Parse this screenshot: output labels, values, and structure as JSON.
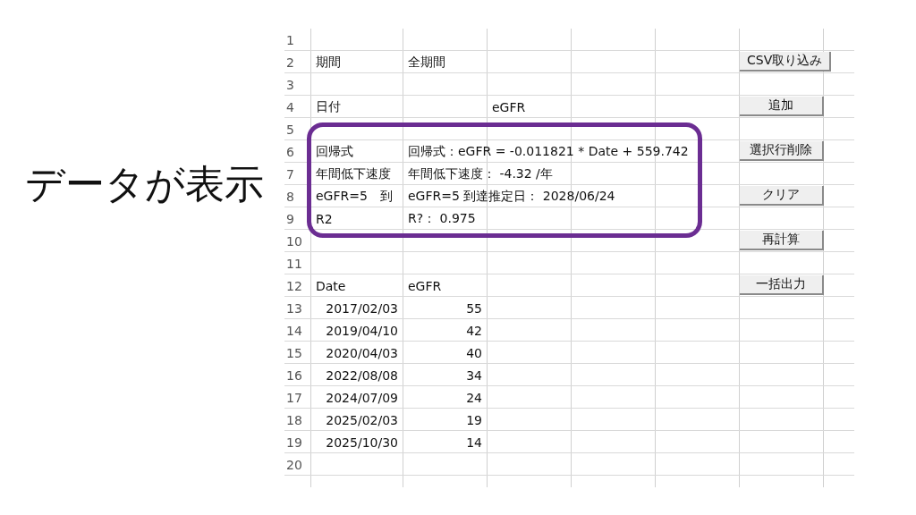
{
  "caption": "データが表示",
  "sheet": {
    "rows": [
      {
        "number": "1"
      },
      {
        "number": "2",
        "column_1": "期間",
        "column_2": "全期間",
        "button": "CSV取り込み"
      },
      {
        "number": "3"
      },
      {
        "number": "4",
        "column_1": "日付",
        "column_3": "eGFR",
        "button": "追加"
      },
      {
        "number": "5"
      },
      {
        "number": "6",
        "column_1": "回帰式",
        "column_2": "回帰式：eGFR = -0.011821 * Date + 559.742",
        "button": "選択行削除"
      },
      {
        "number": "7",
        "column_1": "年間低下速度",
        "column_2": "年間低下速度： -4.32 /年"
      },
      {
        "number": "8",
        "column_1": "eGFR=5　到",
        "column_2": "eGFR=5 到達推定日： 2028/06/24",
        "button": "クリア"
      },
      {
        "number": "9",
        "column_1": "R2",
        "column_2": "R?： 0.975"
      },
      {
        "number": "10",
        "button": "再計算"
      },
      {
        "number": "11"
      },
      {
        "number": "12",
        "column_1": "Date",
        "column_2": "eGFR",
        "button": "一括出力"
      },
      {
        "number": "13",
        "kind": "data",
        "column_1": "2017/02/03",
        "column_2": "55"
      },
      {
        "number": "14",
        "kind": "data",
        "column_1": "2019/04/10",
        "column_2": "42"
      },
      {
        "number": "15",
        "kind": "data",
        "column_1": "2020/04/03",
        "column_2": "40"
      },
      {
        "number": "16",
        "kind": "data",
        "column_1": "2022/08/08",
        "column_2": "34"
      },
      {
        "number": "17",
        "kind": "data",
        "column_1": "2024/07/09",
        "column_2": "24"
      },
      {
        "number": "18",
        "kind": "data",
        "column_1": "2025/02/03",
        "column_2": "19"
      },
      {
        "number": "19",
        "kind": "data",
        "column_1": "2025/10/30",
        "column_2": "14"
      },
      {
        "number": "20"
      }
    ]
  }
}
